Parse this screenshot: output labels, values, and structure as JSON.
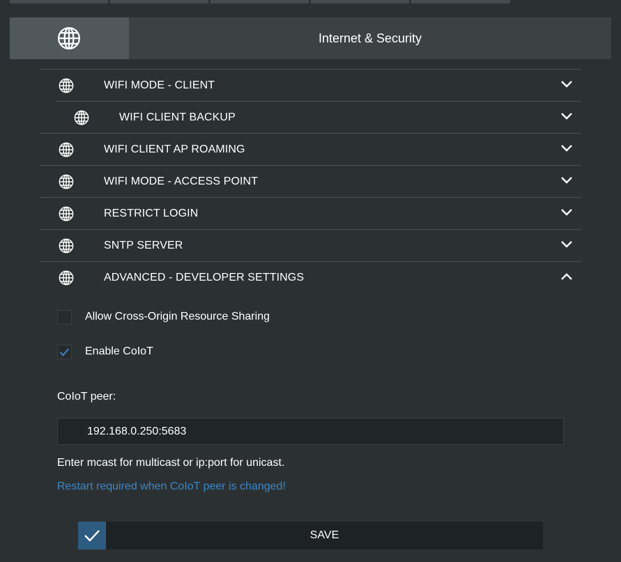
{
  "header": {
    "title": "Internet & Security",
    "icon": "globe-icon"
  },
  "top_tabs": [
    "",
    "",
    "",
    "",
    ""
  ],
  "menu": {
    "items": [
      {
        "label": "WIFI MODE - CLIENT",
        "expanded": false
      },
      {
        "label": "WIFI CLIENT BACKUP",
        "expanded": false,
        "sub": true
      },
      {
        "label": "WIFI CLIENT AP ROAMING",
        "expanded": false
      },
      {
        "label": "WIFI MODE - ACCESS POINT",
        "expanded": false
      },
      {
        "label": "RESTRICT LOGIN",
        "expanded": false
      },
      {
        "label": "SNTP SERVER",
        "expanded": false
      },
      {
        "label": "ADVANCED - DEVELOPER SETTINGS",
        "expanded": true
      }
    ]
  },
  "advanced": {
    "cors": {
      "label": "Allow Cross-Origin Resource Sharing",
      "checked": false
    },
    "coiot": {
      "label": "Enable CoIoT",
      "checked": true
    },
    "peer_label": "CoIoT peer:",
    "peer_value": "192.168.0.250:5683",
    "hint": "Enter mcast for multicast or ip:port for unicast.",
    "warning": "Restart required when CoIoT peer is changed!"
  },
  "save": {
    "label": "SAVE"
  },
  "colors": {
    "background": "#2b3133",
    "accent": "#2d5c80",
    "link": "#3d86c6"
  }
}
